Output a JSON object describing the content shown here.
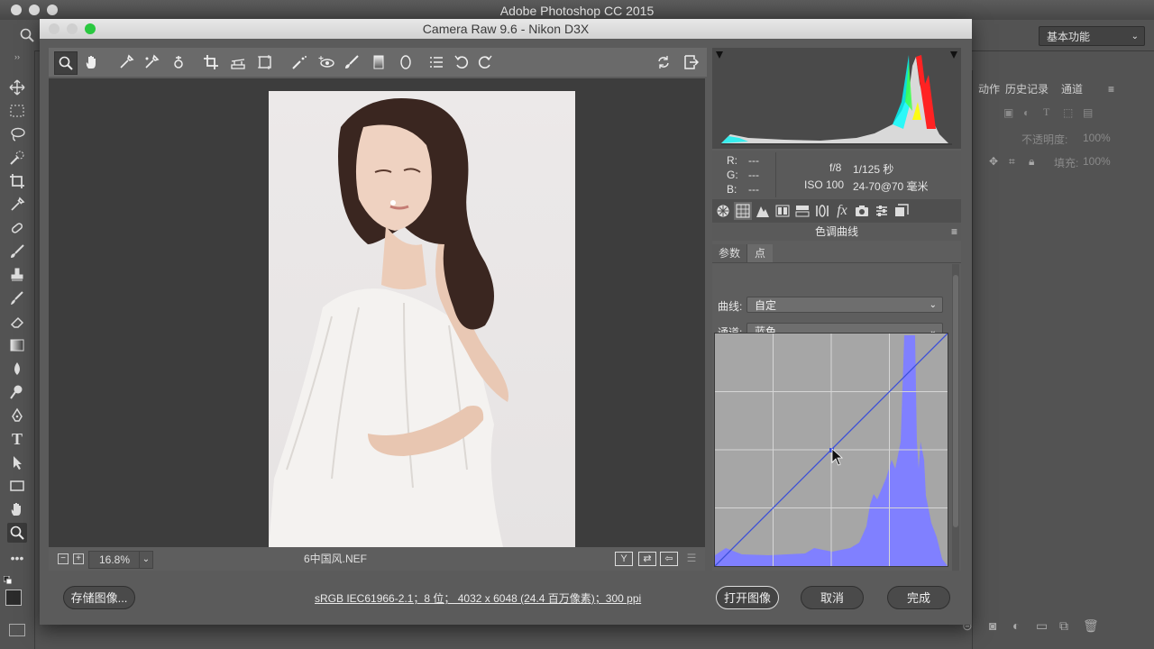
{
  "app": {
    "title": "Adobe Photoshop CC 2015",
    "workspace": "基本功能"
  },
  "right_panel": {
    "tabs": [
      "动作",
      "历史记录",
      "通道"
    ],
    "opacity_label": "不透明度:",
    "opacity_value": "100%",
    "fill_label": "填充:",
    "fill_value": "100%"
  },
  "camera_raw": {
    "title": "Camera Raw 9.6 -  Nikon D3X",
    "zoom": "16.8%",
    "filename": "6中国风.NEF",
    "readout": {
      "r_label": "R:",
      "g_label": "G:",
      "b_label": "B:",
      "r": "---",
      "g": "---",
      "b": "---",
      "aperture": "f/8",
      "shutter": "1/125 秒",
      "iso": "ISO 100",
      "lens": "24-70@70 毫米"
    },
    "panel_title": "色调曲线",
    "subtabs": [
      "参数",
      "点"
    ],
    "curve_label": "曲线:",
    "curve_value": "自定",
    "channel_label": "通道:",
    "channel_value": "蓝色",
    "buttons": {
      "save": "存储图像...",
      "open": "打开图像",
      "cancel": "取消",
      "done": "完成"
    },
    "footer_info": "sRGB IEC61966-2.1；8 位；  4032 x 6048 (24.4 百万像素)；300 ppi",
    "curve_color": "#3b4fd8",
    "histogram_fill": "#8080ff"
  }
}
